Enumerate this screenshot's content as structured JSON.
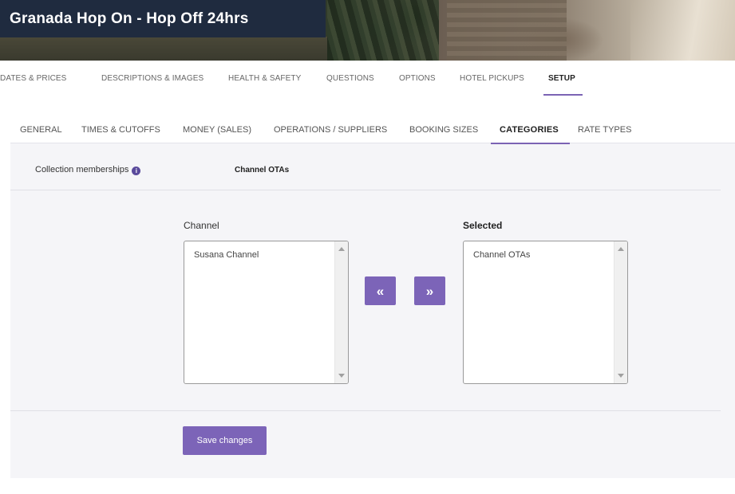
{
  "header": {
    "title": "Granada Hop On - Hop Off 24hrs"
  },
  "top_tabs": [
    {
      "label": "DATES & PRICES"
    },
    {
      "label": "DESCRIPTIONS & IMAGES"
    },
    {
      "label": "HEALTH & SAFETY"
    },
    {
      "label": "QUESTIONS"
    },
    {
      "label": "OPTIONS"
    },
    {
      "label": "HOTEL PICKUPS"
    },
    {
      "label": "SETUP",
      "active": true
    }
  ],
  "sub_tabs": [
    {
      "label": "GENERAL"
    },
    {
      "label": "TIMES & CUTOFFS"
    },
    {
      "label": "MONEY (SALES)"
    },
    {
      "label": "OPERATIONS / SUPPLIERS"
    },
    {
      "label": "BOOKING SIZES"
    },
    {
      "label": "CATEGORIES",
      "active": true
    },
    {
      "label": "RATE TYPES"
    }
  ],
  "membership": {
    "label": "Collection memberships",
    "info_icon": "i",
    "value": "Channel OTAs"
  },
  "lists": {
    "available": {
      "label": "Channel",
      "items": [
        "Susana Channel"
      ]
    },
    "selected": {
      "label": "Selected",
      "items": [
        "Channel OTAs"
      ]
    }
  },
  "buttons": {
    "move_left": "«",
    "move_right": "»",
    "save": "Save changes"
  },
  "colors": {
    "accent": "#7c64b8",
    "title_bg": "#1f2b3f",
    "panel_bg": "#f5f5f8"
  }
}
